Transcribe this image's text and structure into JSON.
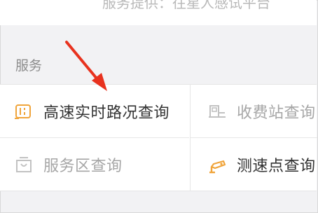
{
  "top": {
    "partial_text": "服务提供：往星人感试平台"
  },
  "section": {
    "title": "服务"
  },
  "services": [
    {
      "label": "高速实时路况查询",
      "icon": "road-traffic-icon",
      "state": "active"
    },
    {
      "label": "收费站查询",
      "icon": "toll-station-icon",
      "state": "disabled"
    },
    {
      "label": "服务区查询",
      "icon": "service-area-icon",
      "state": "disabled"
    },
    {
      "label": "测速点查询",
      "icon": "speed-camera-icon",
      "state": "active"
    }
  ],
  "colors": {
    "accent": "#f0a43a",
    "annotation_arrow": "#e8321e",
    "disabled_icon": "#c2c2c2"
  }
}
